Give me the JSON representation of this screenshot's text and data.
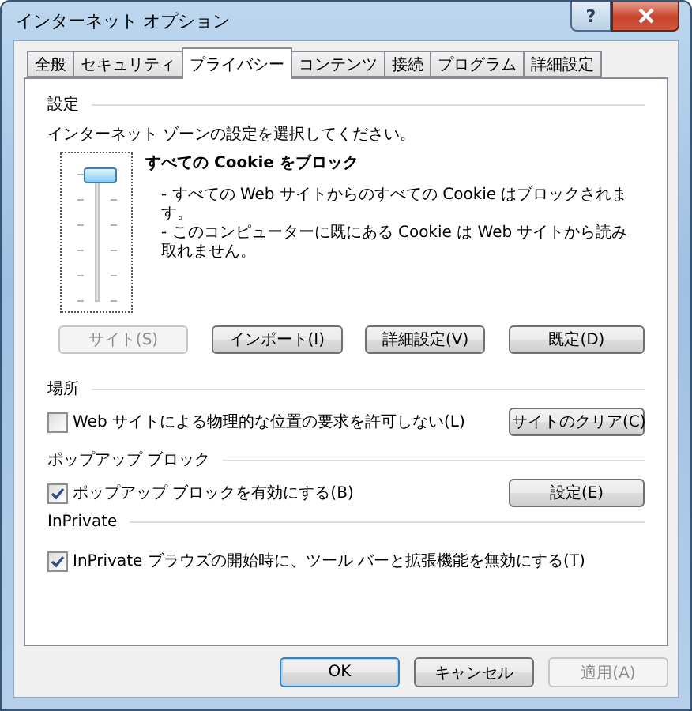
{
  "window": {
    "title": "インターネット オプション",
    "help": "?"
  },
  "tabs": [
    {
      "label": "全般",
      "selected": false
    },
    {
      "label": "セキュリティ",
      "selected": false
    },
    {
      "label": "プライバシー",
      "selected": true
    },
    {
      "label": "コンテンツ",
      "selected": false
    },
    {
      "label": "接続",
      "selected": false
    },
    {
      "label": "プログラム",
      "selected": false
    },
    {
      "label": "詳細設定",
      "selected": false
    }
  ],
  "settings": {
    "heading": "設定",
    "instruction": "インターネット ゾーンの設定を選択してください。",
    "slider": {
      "level": 1
    },
    "level_title": "すべての Cookie をブロック",
    "details": [
      "- すべての Web サイトからのすべての Cookie はブロックされます。",
      "- このコンピューターに既にある Cookie は Web サイトから読み取れません。"
    ],
    "buttons": [
      {
        "label": "サイト(S)",
        "disabled": true
      },
      {
        "label": "インポート(I)",
        "disabled": false
      },
      {
        "label": "詳細設定(V)",
        "disabled": false
      },
      {
        "label": "既定(D)",
        "disabled": false
      }
    ]
  },
  "location": {
    "heading": "場所",
    "checkbox": {
      "label": "Web サイトによる物理的な位置の要求を許可しない(L)",
      "checked": false
    },
    "button": {
      "label": "サイトのクリア(C)",
      "disabled": false
    }
  },
  "popup": {
    "heading": "ポップアップ ブロック",
    "checkbox": {
      "label": "ポップアップ ブロックを有効にする(B)",
      "checked": true
    },
    "button": {
      "label": "設定(E)",
      "disabled": false
    }
  },
  "inprivate": {
    "heading": "InPrivate",
    "checkbox": {
      "label": "InPrivate ブラウズの開始時に、ツール バーと拡張機能を無効にする(T)",
      "checked": true
    }
  },
  "footer": [
    {
      "label": "OK",
      "default": true,
      "disabled": false
    },
    {
      "label": "キャンセル",
      "default": false,
      "disabled": false
    },
    {
      "label": "適用(A)",
      "default": false,
      "disabled": true
    }
  ]
}
